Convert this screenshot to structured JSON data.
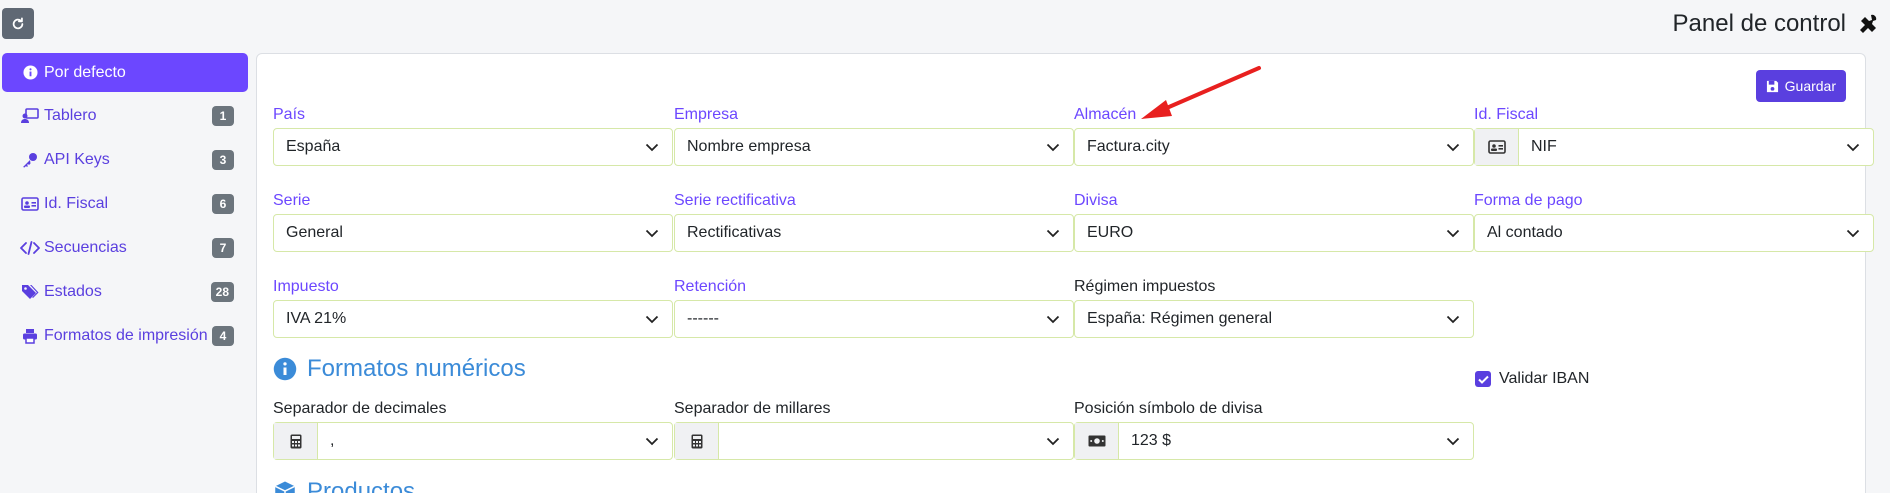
{
  "header": {
    "title": "Panel de control"
  },
  "toolbar": {
    "refresh_icon": "refresh-icon",
    "save_label": "Guardar"
  },
  "sidebar": {
    "items": [
      {
        "label": "Por defecto",
        "icon": "info-circle-icon",
        "badge": ""
      },
      {
        "label": "Tablero",
        "icon": "chalkboard-user-icon",
        "badge": "1"
      },
      {
        "label": "API Keys",
        "icon": "key-icon",
        "badge": "3"
      },
      {
        "label": "Id. Fiscal",
        "icon": "id-card-icon",
        "badge": "6"
      },
      {
        "label": "Secuencias",
        "icon": "code-icon",
        "badge": "7"
      },
      {
        "label": "Estados",
        "icon": "tags-icon",
        "badge": "28"
      },
      {
        "label": "Formatos de impresión",
        "icon": "print-icon",
        "badge": "4"
      }
    ]
  },
  "form": {
    "pais": {
      "label": "País",
      "value": "España"
    },
    "empresa": {
      "label": "Empresa",
      "value": "Nombre empresa"
    },
    "almacen": {
      "label": "Almacén",
      "value": "Factura.city"
    },
    "id_fiscal": {
      "label": "Id. Fiscal",
      "value": "NIF"
    },
    "serie": {
      "label": "Serie",
      "value": "General"
    },
    "serie_rect": {
      "label": "Serie rectificativa",
      "value": "Rectificativas"
    },
    "divisa": {
      "label": "Divisa",
      "value": "EURO"
    },
    "forma_pago": {
      "label": "Forma de pago",
      "value": "Al contado"
    },
    "impuesto": {
      "label": "Impuesto",
      "value": "IVA 21%"
    },
    "retencion": {
      "label": "Retención",
      "value": "------"
    },
    "regimen": {
      "label": "Régimen impuestos",
      "value": "España: Régimen general"
    },
    "validar_iban": {
      "label": "Validar IBAN",
      "checked": true
    }
  },
  "formatos": {
    "title": "Formatos numéricos",
    "sep_decimales": {
      "label": "Separador de decimales",
      "value": ","
    },
    "sep_millares": {
      "label": "Separador de millares",
      "value": ""
    },
    "pos_simbolo": {
      "label": "Posición símbolo de divisa",
      "value": "123 $"
    }
  },
  "productos": {
    "title": "Productos"
  },
  "colors": {
    "accent": "#6c47ff",
    "button": "#5a3fdf",
    "section": "#3b8bd8",
    "annotation": "#e8201f"
  }
}
